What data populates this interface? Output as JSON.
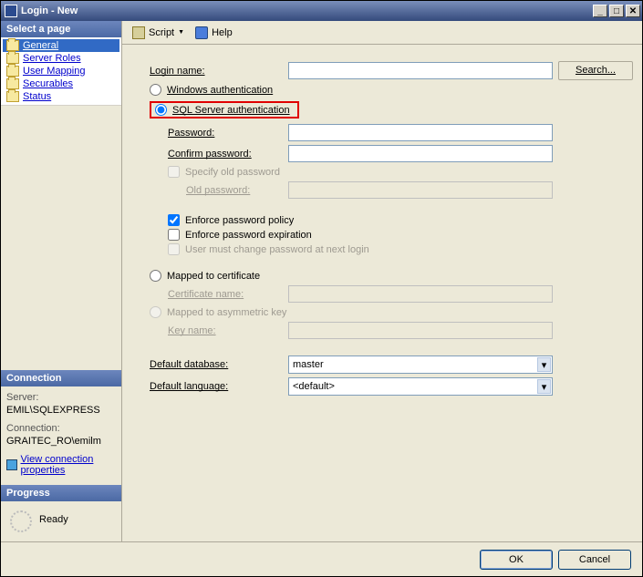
{
  "window": {
    "title": "Login - New"
  },
  "left": {
    "select_page": "Select a page",
    "pages": [
      "General",
      "Server Roles",
      "User Mapping",
      "Securables",
      "Status"
    ],
    "connection_header": "Connection",
    "server_label": "Server:",
    "server_value": "EMIL\\SQLEXPRESS",
    "connection_label": "Connection:",
    "connection_value": "GRAITEC_RO\\emilm",
    "view_conn_link": "View connection properties",
    "progress_header": "Progress",
    "progress_status": "Ready"
  },
  "toolbar": {
    "script": "Script",
    "help": "Help"
  },
  "form": {
    "login_name_label": "Login name:",
    "search_btn": "Search...",
    "windows_auth": "Windows authentication",
    "sql_auth": "SQL Server authentication",
    "password": "Password:",
    "confirm_password": "Confirm password:",
    "specify_old": "Specify old password",
    "old_password": "Old password:",
    "enforce_policy": "Enforce password policy",
    "enforce_expiration": "Enforce password expiration",
    "must_change": "User must change password at next login",
    "mapped_cert": "Mapped to certificate",
    "cert_name": "Certificate name:",
    "mapped_asym": "Mapped to asymmetric key",
    "key_name": "Key name:",
    "default_db": "Default database:",
    "default_db_value": "master",
    "default_lang": "Default language:",
    "default_lang_value": "<default>"
  },
  "footer": {
    "ok": "OK",
    "cancel": "Cancel"
  }
}
